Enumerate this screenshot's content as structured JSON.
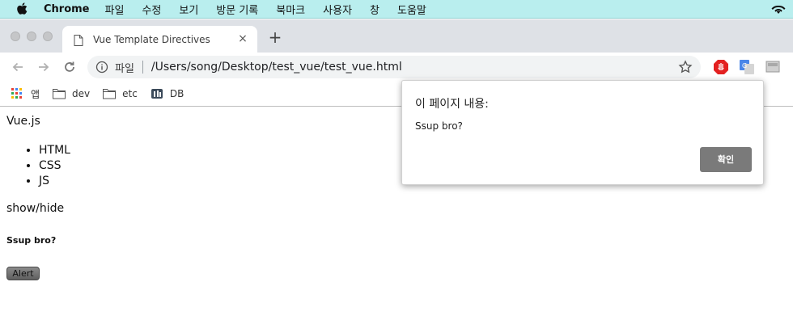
{
  "menubar": {
    "app_name": "Chrome",
    "items": [
      "파일",
      "수정",
      "보기",
      "방문 기록",
      "북마크",
      "사용자",
      "창",
      "도움말"
    ]
  },
  "tab": {
    "title": "Vue Template Directives",
    "close": "×"
  },
  "newtab": "+",
  "omnibox": {
    "scheme_label": "파일",
    "url": "/Users/song/Desktop/test_vue/test_vue.html"
  },
  "bookmarks": [
    {
      "label": "앱",
      "icon": "apps-grid-icon"
    },
    {
      "label": "dev",
      "icon": "folder-icon"
    },
    {
      "label": "etc",
      "icon": "folder-icon"
    },
    {
      "label": "DB",
      "icon": "db-icon"
    }
  ],
  "page": {
    "title": "Vue.js",
    "list": [
      "HTML",
      "CSS",
      "JS"
    ],
    "toggle_text": "show/hide",
    "message": "Ssup bro?",
    "alert_button": "Alert"
  },
  "dialog": {
    "title": "이 페이지 내용:",
    "message": "Ssup bro?",
    "ok_label": "확인"
  },
  "colors": {
    "menubar_bg": "#b9eeee",
    "tabstrip_bg": "#dee1e6",
    "dialog_button": "#7a7a7a"
  }
}
